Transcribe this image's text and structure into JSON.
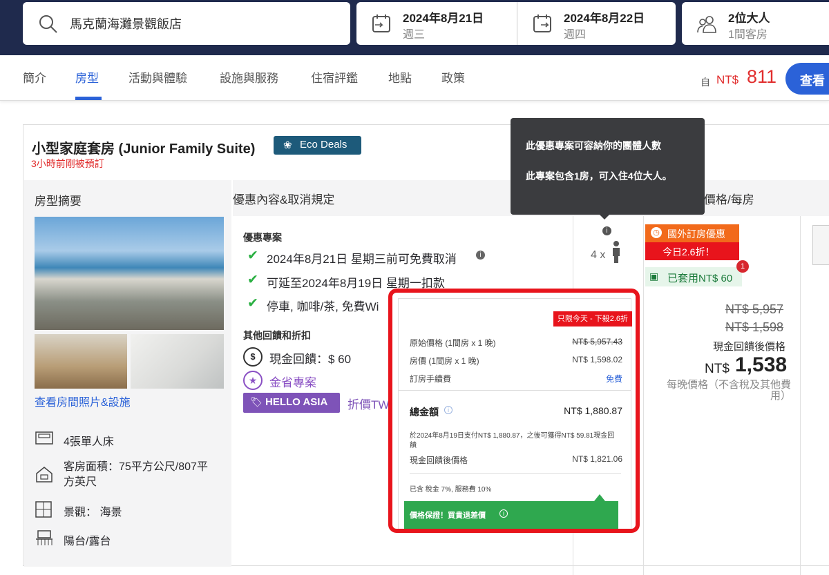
{
  "search": {
    "hotel": "馬克蘭海灘景觀飯店"
  },
  "dates": {
    "checkin_date": "2024年8月21日",
    "checkin_day": "週三",
    "checkout_date": "2024年8月22日",
    "checkout_day": "週四"
  },
  "guests": {
    "adults": "2位大人",
    "rooms": "1間客房"
  },
  "tabs": [
    "簡介",
    "房型",
    "活動與體驗",
    "設施與服務",
    "住宿評鑑",
    "地點",
    "政策"
  ],
  "header_price": {
    "prefix": "自",
    "currency": "NT$",
    "amount": "811",
    "cta": "查看"
  },
  "room": {
    "name": "小型家庭套房 (Junior Family Suite)",
    "eco_badge": "Eco Deals",
    "recent_booking": "3小時前剛被預訂",
    "summary_header": "房型摘要",
    "photos_link": "查看房間照片&設施",
    "features": [
      {
        "icon": "bed-icon",
        "text": "4張單人床"
      },
      {
        "icon": "house-icon",
        "text": "客房面積：75平方公尺/807平方英尺"
      },
      {
        "icon": "window-icon",
        "text": "景觀： 海景"
      },
      {
        "icon": "balcony-icon",
        "text": "陽台/露台"
      }
    ]
  },
  "deals": {
    "header": "優惠內容&取消規定",
    "section_title": "優惠專案",
    "items": [
      "2024年8月21日 星期三前可免費取消",
      "可延至2024年8月19日 星期一扣款",
      "停車, 咖啡/茶, 免費Wi"
    ],
    "other_title": "其他回饋和折扣",
    "cashback": "現金回饋：$ 60",
    "gold": "金省專案",
    "hello_asia": "HELLO ASIA",
    "discount_text": "折價TW"
  },
  "capacity": {
    "label": "4 x"
  },
  "tooltip": {
    "line1": "此優惠專案可容納你的團體人數",
    "line2": "此專案包含1房，可入住4位大人。"
  },
  "price_col": {
    "header": "晚價格/每房",
    "badge1": "國外訂房優惠",
    "badge2": "今日2.6折！",
    "coupon": "已套用NT$ 60",
    "coupon_count": "1",
    "strike1": "NT$ 5,957",
    "strike2": "NT$ 1,598",
    "cashback_label": "現金回饋後價格",
    "currency": "NT$",
    "final": "1,538",
    "note": "每晚價格（不含稅及其他費用）"
  },
  "popup": {
    "tag": "只限今天 - 下殺2.6折",
    "orig_label": "原始價格 (1間房 x 1 晚)",
    "orig_value": "NT$ 5,957.43",
    "room_label": "房價 (1間房 x 1 晚)",
    "room_value": "NT$ 1,598.02",
    "fee_label": "訂房手續費",
    "fee_value": "免費",
    "total_label": "總金額",
    "total_value": "NT$ 1,880.87",
    "pay_note": "於2024年8月19日支付NT$ 1,880.87，之後可獲得NT$ 59.81現金回饋",
    "after_label": "現金回饋後價格",
    "after_value": "NT$ 1,821.06",
    "tax_note": "已含 稅金 7%, 服務費 10%",
    "guarantee": "價格保證！買貴退差價"
  }
}
